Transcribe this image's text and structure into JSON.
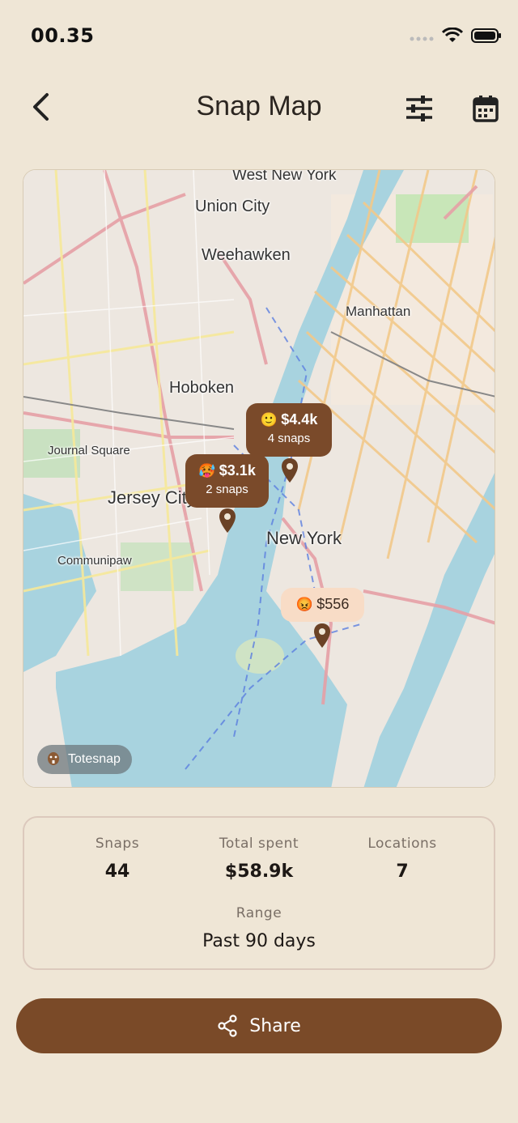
{
  "status": {
    "time": "00.35"
  },
  "header": {
    "title": "Snap Map"
  },
  "map": {
    "labels": [
      {
        "text": "West New York"
      },
      {
        "text": "Union City"
      },
      {
        "text": "Weehawken"
      },
      {
        "text": "Manhattan"
      },
      {
        "text": "Hoboken"
      },
      {
        "text": "Journal Square"
      },
      {
        "text": "Jersey City"
      },
      {
        "text": "New York"
      },
      {
        "text": "Communipaw"
      }
    ],
    "markers": [
      {
        "emoji": "🙂",
        "amount": "$4.4k",
        "count": "4 snaps"
      },
      {
        "emoji": "🥵",
        "amount": "$3.1k",
        "count": "2 snaps"
      },
      {
        "emoji": "😡",
        "amount": "$556",
        "count": ""
      }
    ],
    "brand": "Totesnap"
  },
  "stats": {
    "snaps_label": "Snaps",
    "snaps_value": "44",
    "spent_label": "Total spent",
    "spent_value": "$58.9k",
    "locations_label": "Locations",
    "locations_value": "7",
    "range_label": "Range",
    "range_value": "Past 90 days"
  },
  "share": {
    "label": "Share"
  },
  "colors": {
    "accent": "#7a4a28",
    "background": "#efe6d6",
    "water": "#a8d3df",
    "bubble_light": "#f8dcc6"
  }
}
